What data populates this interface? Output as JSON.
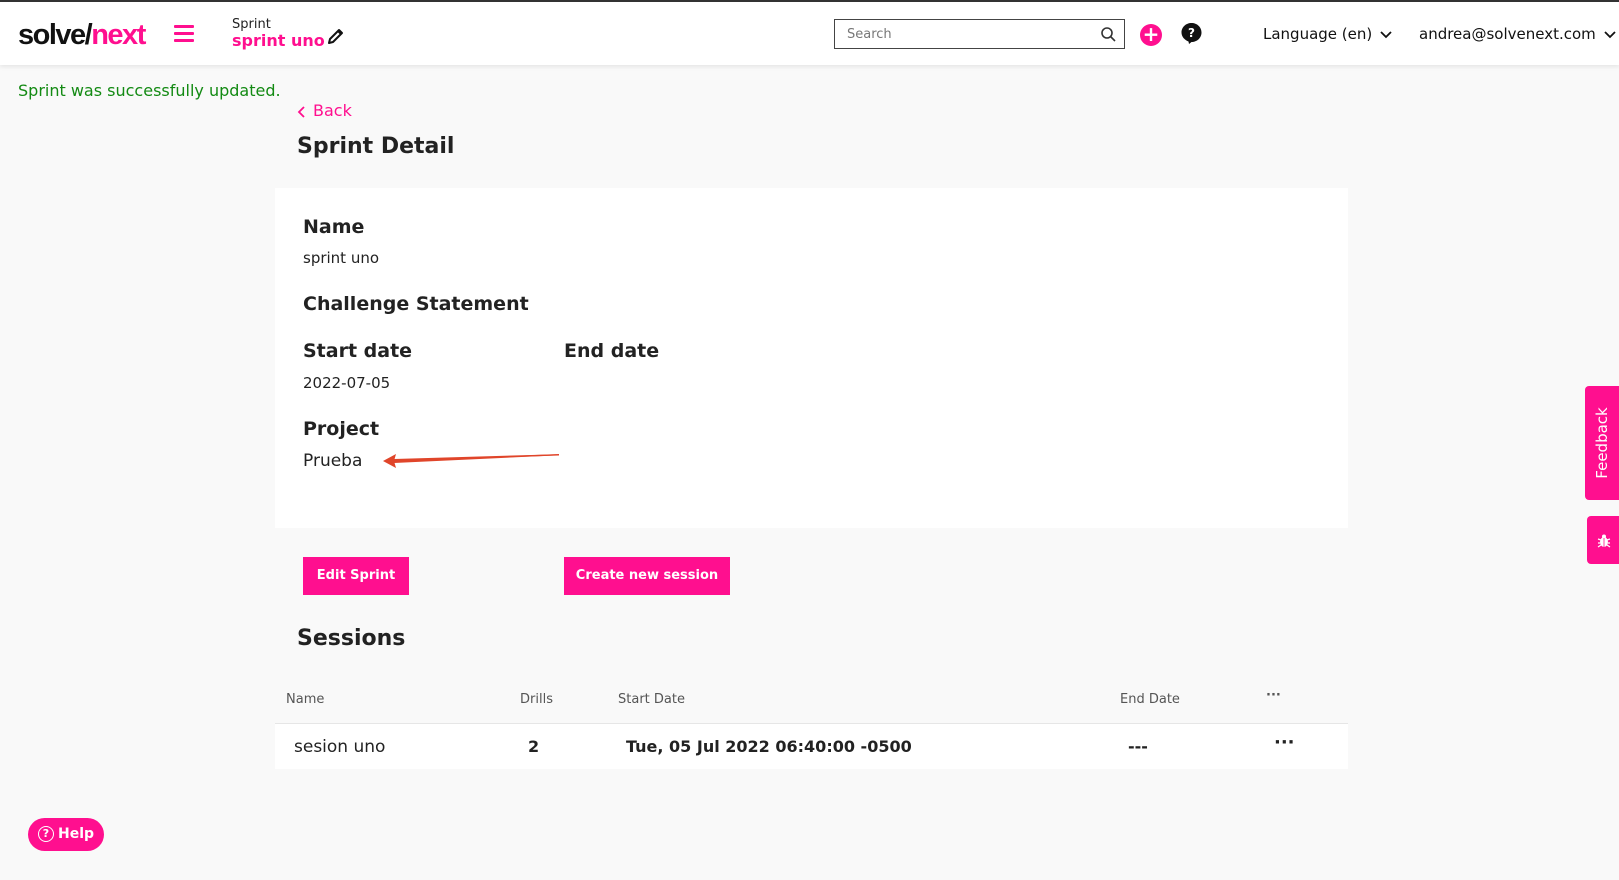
{
  "brand": {
    "logo_part1": "solve/",
    "logo_part2": "next",
    "accent_color": "#ff0f8f"
  },
  "header": {
    "breadcrumb_label": "Sprint",
    "breadcrumb_title": "sprint uno",
    "search_placeholder": "Search",
    "language_label": "Language (en)",
    "user_email": "andrea@solvenext.com"
  },
  "flash": {
    "message": "Sprint was successfully updated."
  },
  "page": {
    "back_label": "Back",
    "title": "Sprint Detail"
  },
  "details": {
    "name_label": "Name",
    "name_value": "sprint uno",
    "challenge_label": "Challenge Statement",
    "start_label": "Start date",
    "start_value": "2022-07-05",
    "end_label": "End date",
    "project_label": "Project",
    "project_value": "Prueba"
  },
  "actions": {
    "edit_sprint": "Edit Sprint",
    "create_session": "Create new session"
  },
  "sessions": {
    "title": "Sessions",
    "columns": [
      "Name",
      "Drills",
      "Start Date",
      "End Date",
      "···"
    ],
    "rows": [
      {
        "name": "sesion uno",
        "drills": "2",
        "start_date": "Tue, 05 Jul 2022 06:40:00 -0500",
        "end_date": "---",
        "menu": "···"
      }
    ]
  },
  "widgets": {
    "feedback_label": "Feedback",
    "help_label": "Help"
  },
  "icons": [
    "menu-icon",
    "pencil-icon",
    "search-icon",
    "plus-icon",
    "question-icon",
    "chevron-down-icon",
    "chevron-left-icon",
    "bug-icon",
    "help-circle-icon"
  ]
}
